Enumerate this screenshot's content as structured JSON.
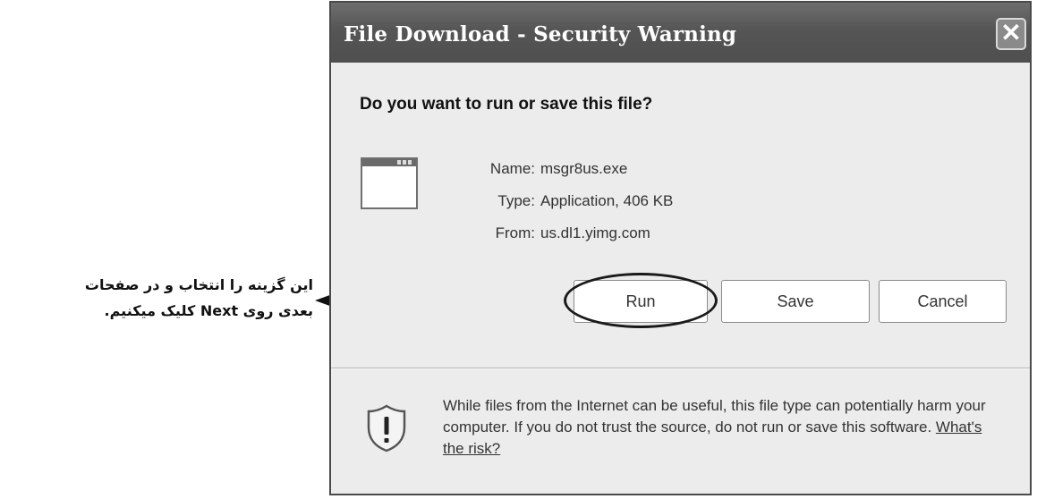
{
  "annotation": {
    "line1": "این گزینه را انتخاب و در صفحات",
    "line2": "بعدی روی Next کلیک میکنیم."
  },
  "dialog": {
    "title": "File Download - Security Warning",
    "close_icon": "close-icon",
    "heading": "Do you want to run or save this file?",
    "file_icon": "application-window-icon",
    "fields": [
      {
        "label": "Name:",
        "value": "msgr8us.exe"
      },
      {
        "label": "Type:",
        "value": "Application, 406 KB"
      },
      {
        "label": "From:",
        "value": "us.dl1.yimg.com"
      }
    ],
    "buttons": {
      "run": "Run",
      "save": "Save",
      "cancel": "Cancel"
    },
    "warning": {
      "icon": "shield-warning-icon",
      "text": "While files from the Internet can be useful, this file type can potentially harm your computer. If you do not trust the source, do not run or save this software.",
      "link": "What's the risk?"
    }
  },
  "colors": {
    "titlebar": "#555555",
    "dialog_bg": "#ececec",
    "annotation": "#111111"
  }
}
